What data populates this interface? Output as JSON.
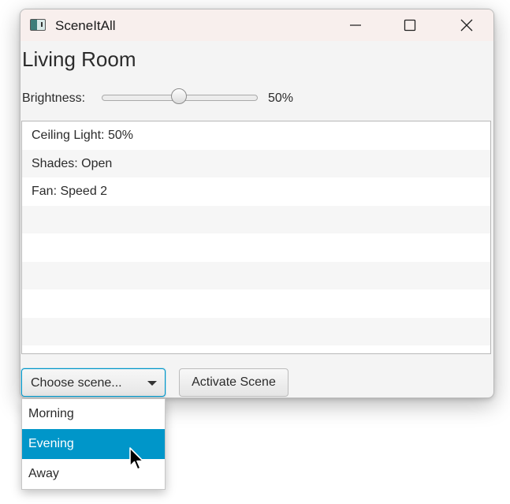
{
  "window": {
    "title": "SceneItAll",
    "icon": "app-icon",
    "controls": [
      "minimize-icon",
      "maximize-icon",
      "close-icon"
    ]
  },
  "room": {
    "title": "Living Room"
  },
  "brightness": {
    "label": "Brightness:",
    "value_text": "50%",
    "value_fraction": 0.5
  },
  "devices": [
    "Ceiling Light: 50%",
    "Shades: Open",
    "Fan: Speed 2",
    "",
    "",
    "",
    "",
    "",
    ""
  ],
  "scene_combo": {
    "placeholder": "Choose scene...",
    "options": [
      "Morning",
      "Evening",
      "Away"
    ],
    "highlighted_index": 1
  },
  "activate_button": {
    "label": "Activate Scene"
  },
  "colors": {
    "accent": "#0096c9",
    "titlebar": "#f8efed"
  }
}
